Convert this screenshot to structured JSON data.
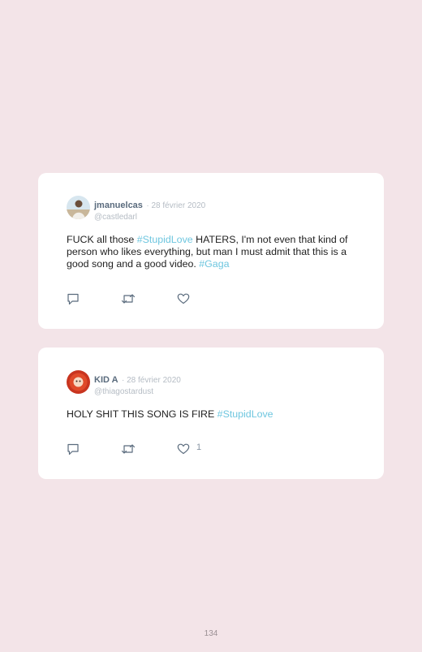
{
  "tweets": [
    {
      "name": "jmanuelcas",
      "date": "· 28 février 2020",
      "handle": "@castledarl",
      "text_parts": [
        "FUCK all those ",
        "#StupidLove",
        " HATERS, I'm not even that kind of person who likes everything, but man I must admit that this is a good song and a good video. ",
        "#Gaga"
      ],
      "like_count": ""
    },
    {
      "name": "KID A",
      "date": "· 28 février 2020",
      "handle": "@thiagostardust",
      "text_parts": [
        "HOLY SHIT THIS SONG IS FIRE ",
        "#StupidLove"
      ],
      "like_count": "1"
    }
  ],
  "icons": [
    "reply-icon",
    "retweet-icon",
    "like-icon"
  ],
  "colors": {
    "background": "#f3e4e8",
    "hashtag": "#6ec6df",
    "name": "#5a6b7d",
    "meta": "#b5bcc4"
  },
  "page_number": "134"
}
